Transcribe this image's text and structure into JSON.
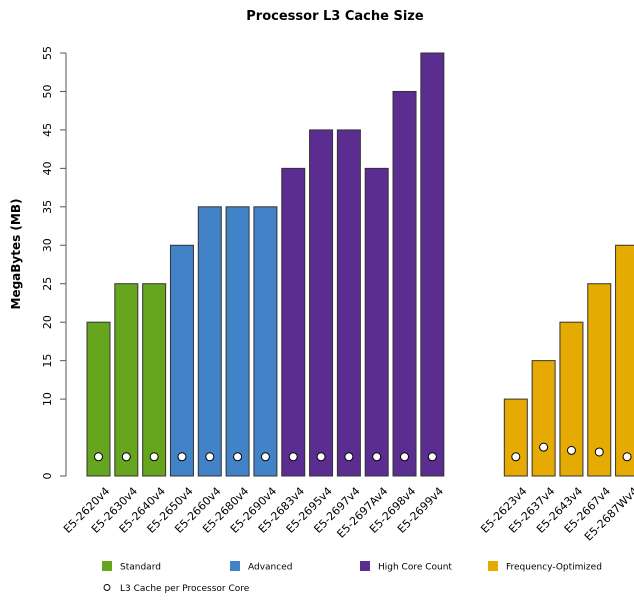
{
  "chart_data": {
    "type": "bar",
    "title": "Processor L3 Cache Size",
    "xlabel": "",
    "ylabel": "MegaBytes (MB)",
    "ylim": [
      0,
      55
    ],
    "yticks": [
      0,
      10,
      15,
      20,
      25,
      30,
      35,
      40,
      45,
      50,
      55
    ],
    "grid": false,
    "categories": [
      "E5-2620v4",
      "E5-2630v4",
      "E5-2640v4",
      "E5-2650v4",
      "E5-2660v4",
      "E5-2680v4",
      "E5-2690v4",
      "E5-2683v4",
      "E5-2695v4",
      "E5-2697v4",
      "E5-2697Av4",
      "E5-2698v4",
      "E5-2699v4",
      "E5-2623v4",
      "E5-2637v4",
      "E5-2643v4",
      "E5-2667v4",
      "E5-2687Wv4"
    ],
    "groups": [
      {
        "name": "Standard",
        "color": "#66a61e",
        "categories": [
          "E5-2620v4",
          "E5-2630v4",
          "E5-2640v4"
        ]
      },
      {
        "name": "Advanced",
        "color": "#4282c6",
        "categories": [
          "E5-2650v4",
          "E5-2660v4",
          "E5-2680v4",
          "E5-2690v4"
        ]
      },
      {
        "name": "High Core Count",
        "color": "#5c2d91",
        "categories": [
          "E5-2683v4",
          "E5-2695v4",
          "E5-2697v4",
          "E5-2697Av4",
          "E5-2698v4",
          "E5-2699v4"
        ]
      },
      {
        "name": "Frequency-Optimized",
        "color": "#e6ab02",
        "categories": [
          "E5-2623v4",
          "E5-2637v4",
          "E5-2643v4",
          "E5-2667v4",
          "E5-2687Wv4"
        ]
      }
    ],
    "series": [
      {
        "name": "L3 Cache Size",
        "type": "bar",
        "values": [
          20,
          25,
          25,
          30,
          35,
          35,
          35,
          40,
          45,
          45,
          40,
          50,
          55,
          10,
          15,
          20,
          25,
          30
        ]
      },
      {
        "name": "L3 Cache per Processor Core",
        "type": "point",
        "values": [
          2.5,
          2.5,
          2.5,
          2.5,
          2.5,
          2.5,
          2.5,
          2.5,
          2.5,
          2.5,
          2.5,
          2.5,
          2.5,
          2.5,
          3.75,
          3.33,
          3.125,
          2.5
        ]
      }
    ],
    "legend": {
      "placement": "bottom",
      "entries": [
        {
          "label": "Standard",
          "color": "#66a61e",
          "symbol": "square"
        },
        {
          "label": "Advanced",
          "color": "#4282c6",
          "symbol": "square"
        },
        {
          "label": "High Core Count",
          "color": "#5c2d91",
          "symbol": "square"
        },
        {
          "label": "Frequency-Optimized",
          "color": "#e6ab02",
          "symbol": "square"
        },
        {
          "label": "L3 Cache per Processor Core",
          "color": "#ffffff",
          "symbol": "circle"
        }
      ]
    }
  }
}
